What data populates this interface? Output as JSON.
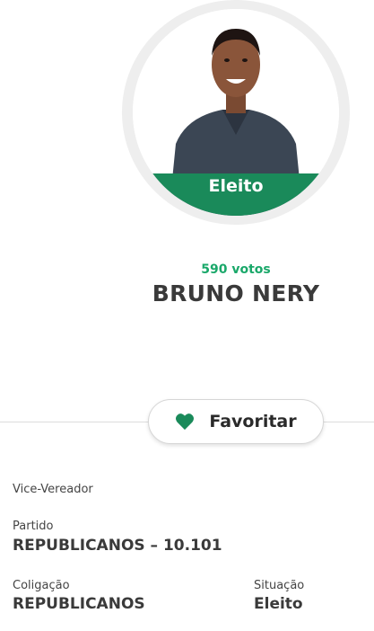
{
  "candidate": {
    "status_badge": "Eleito",
    "votes": "590 votos",
    "name": "BRUNO NERY"
  },
  "favorite": {
    "label": "Favoritar",
    "icon": "heart-icon",
    "icon_color": "#1a8a5a"
  },
  "details": {
    "role": "Vice-Vereador",
    "party_label": "Partido",
    "party_value": "REPUBLICANOS – 10.101",
    "coalition_label": "Coligação",
    "coalition_value": "REPUBLICANOS",
    "situation_label": "Situação",
    "situation_value": "Eleito"
  },
  "colors": {
    "accent_green": "#1a8a5a",
    "votes_green": "#1aa86a"
  }
}
